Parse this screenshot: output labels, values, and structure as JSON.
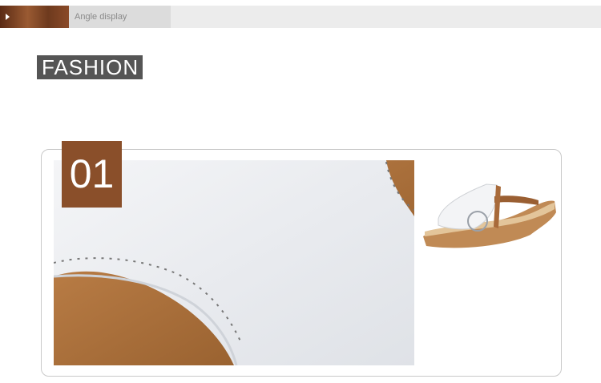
{
  "header": {
    "label": "Angle display",
    "accent_color": "#8a4f2a",
    "arrow_icon": "play-triangle-icon"
  },
  "section": {
    "title": "FASHION"
  },
  "feature": {
    "number": "01",
    "badge_color": "#8a4f2a"
  }
}
